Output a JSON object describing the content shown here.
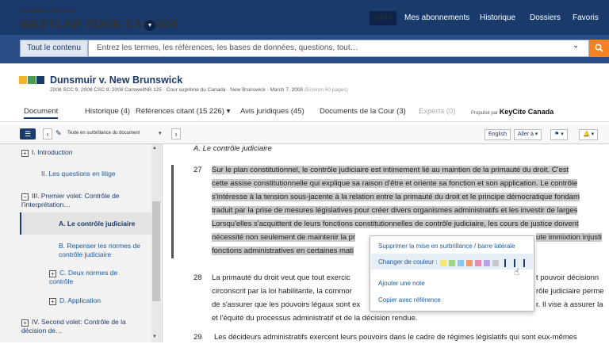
{
  "header": {
    "brand_small": "THOMSON REUTERS",
    "brand": "WESTLAW EDGE CANADA",
    "count": "2468",
    "nav": [
      "Mes abonnements",
      "Historique",
      "Dossiers",
      "Favoris"
    ]
  },
  "search": {
    "tab_label": "Tout le contenu",
    "placeholder": "Entrez les termes, les références, les bases de données, questions, tout…"
  },
  "document": {
    "title": "Dunsmuir v. New Brunswick",
    "citation": "2008 SCC 9, 2008 CSC 9, 2008 CarswellNB 125 · Cour suprême du Canada · New Brunswick · March 7, 2008",
    "pages": "(Environ 60 pages)"
  },
  "tabs": [
    {
      "label": "Document"
    },
    {
      "label": "Historique (4)"
    },
    {
      "label": "Références citant (15 226) ▾"
    },
    {
      "label": "Avis juridiques (45)"
    },
    {
      "label": "Documents de la Cour (3)"
    },
    {
      "label": "Experts (0)"
    }
  ],
  "keycite": {
    "prefix": "Propulsé par",
    "brand": "KeyCite Canada"
  },
  "toolbar": {
    "highlight_label": "Texte en surbrillance du document",
    "english": "English",
    "goto": "Aller à ▾"
  },
  "toc": [
    {
      "label": "I. Introduction",
      "box": "+"
    },
    {
      "label": "II. Les questions en litige",
      "box": ""
    },
    {
      "label": "III. Premier volet: Contrôle de l’interprétation…",
      "box": "−"
    },
    {
      "label": "A. Le contrôle judiciaire",
      "box": ""
    },
    {
      "label": "B. Repenser les normes de contrôle judiciaire",
      "box": ""
    },
    {
      "label": "C. Deux normes de contrôle",
      "box": "+"
    },
    {
      "label": "D. Application",
      "box": "+"
    },
    {
      "label": "IV. Second volet: Contrôle de la décision de…",
      "box": "+"
    }
  ],
  "content": {
    "section": "A. Le contrôle judiciaire",
    "p27_num": "27",
    "p27": [
      "Sur le plan constitutionnel, le contrôle judiciaire est intimement lié au maintien de la primauté du droit. C'est",
      "cette assise constitutionnelle qui explique sa raison d'être et oriente sa fonction et son application. Le contrôle",
      "s'intéresse à la tension sous-jacente à la relation entre la primauté du droit et le principe démocratique fondam",
      "traduit par la prise de mesures législatives pour créer divers organismes administratifs et les investir de larges",
      "Lorsqu'elles s'acquittent de leurs fonctions constitutionnelles de contrôle judiciaire, les cours de justice doivent",
      "nécessité non seulement de maintenir la pr",
      "fonctions administratives en certaines mati"
    ],
    "p27_tail5": "ute immixtion injusti",
    "p28_num": "28",
    "p28": [
      "La primauté du droit veut que tout exercic",
      "circonscrit par la loi habilitante, la commor",
      "de s'assurer que les pouvoirs légaux sont ex",
      "et l'équité du processus administratif et de la décision rendue."
    ],
    "p28_tails": [
      "t pouvoir décisionn",
      "rôle judiciaire perme",
      "r. Il vise à assurer la"
    ],
    "p29_num": "29",
    "p29": "Les décideurs administratifs exercent leurs pouvoirs dans le cadre de régimes législatifs qui sont eux-mêmes"
  },
  "popup": {
    "remove": "Supprimer la mise en surbrillance / barre latérale",
    "change_color": "Changer de couleur :",
    "add_note": "Ajouter une note",
    "copy_ref": "Copier avec référence",
    "colors": [
      "#f5e86a",
      "#9fd884",
      "#8ec7ee",
      "#f19a6b",
      "#e98ab0",
      "#b9a2e6",
      "#c8c8c8"
    ]
  }
}
